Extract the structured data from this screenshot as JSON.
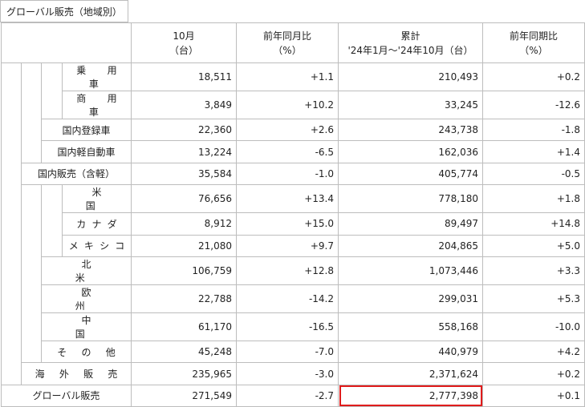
{
  "title": "グローバル販売（地域別）",
  "headers": {
    "col1": [
      "10月",
      "（台）"
    ],
    "col2": [
      "前年同月比",
      "（%）"
    ],
    "col3": [
      "累計",
      "'24年1月〜'24年10月（台）"
    ],
    "col4": [
      "前年同期比",
      "（%）"
    ]
  },
  "rows": [
    {
      "label": "乗　用　車",
      "m": "18,511",
      "mp": "+1.1",
      "c": "210,493",
      "cp": "+0.2"
    },
    {
      "label": "商　用　車",
      "m": "3,849",
      "mp": "+10.2",
      "c": "33,245",
      "cp": "-12.6"
    },
    {
      "label": "国内登録車",
      "m": "22,360",
      "mp": "+2.6",
      "c": "243,738",
      "cp": "-1.8"
    },
    {
      "label": "国内軽自動車",
      "m": "13,224",
      "mp": "-6.5",
      "c": "162,036",
      "cp": "+1.4"
    },
    {
      "label": "国内販売（含軽）",
      "m": "35,584",
      "mp": "-1.0",
      "c": "405,774",
      "cp": "-0.5"
    },
    {
      "label": "米　　国",
      "m": "76,656",
      "mp": "+13.4",
      "c": "778,180",
      "cp": "+1.8"
    },
    {
      "label": "カナダ",
      "m": "8,912",
      "mp": "+15.0",
      "c": "89,497",
      "cp": "+14.8"
    },
    {
      "label": "メキシコ",
      "m": "21,080",
      "mp": "+9.7",
      "c": "204,865",
      "cp": "+5.0"
    },
    {
      "label": "北　　米",
      "m": "106,759",
      "mp": "+12.8",
      "c": "1,073,446",
      "cp": "+3.3"
    },
    {
      "label": "欧　　州",
      "m": "22,788",
      "mp": "-14.2",
      "c": "299,031",
      "cp": "+5.3"
    },
    {
      "label": "中　　国",
      "m": "61,170",
      "mp": "-16.5",
      "c": "558,168",
      "cp": "-10.0"
    },
    {
      "label": "そ の 他",
      "m": "45,248",
      "mp": "-7.0",
      "c": "440,979",
      "cp": "+4.2"
    },
    {
      "label": "海 外 販 売",
      "m": "235,965",
      "mp": "-3.0",
      "c": "2,371,624",
      "cp": "+0.2"
    },
    {
      "label": "グローバル販売",
      "m": "271,549",
      "mp": "-2.7",
      "c": "2,777,398",
      "cp": "+0.1"
    }
  ],
  "highlight_color": "#e01b1b"
}
